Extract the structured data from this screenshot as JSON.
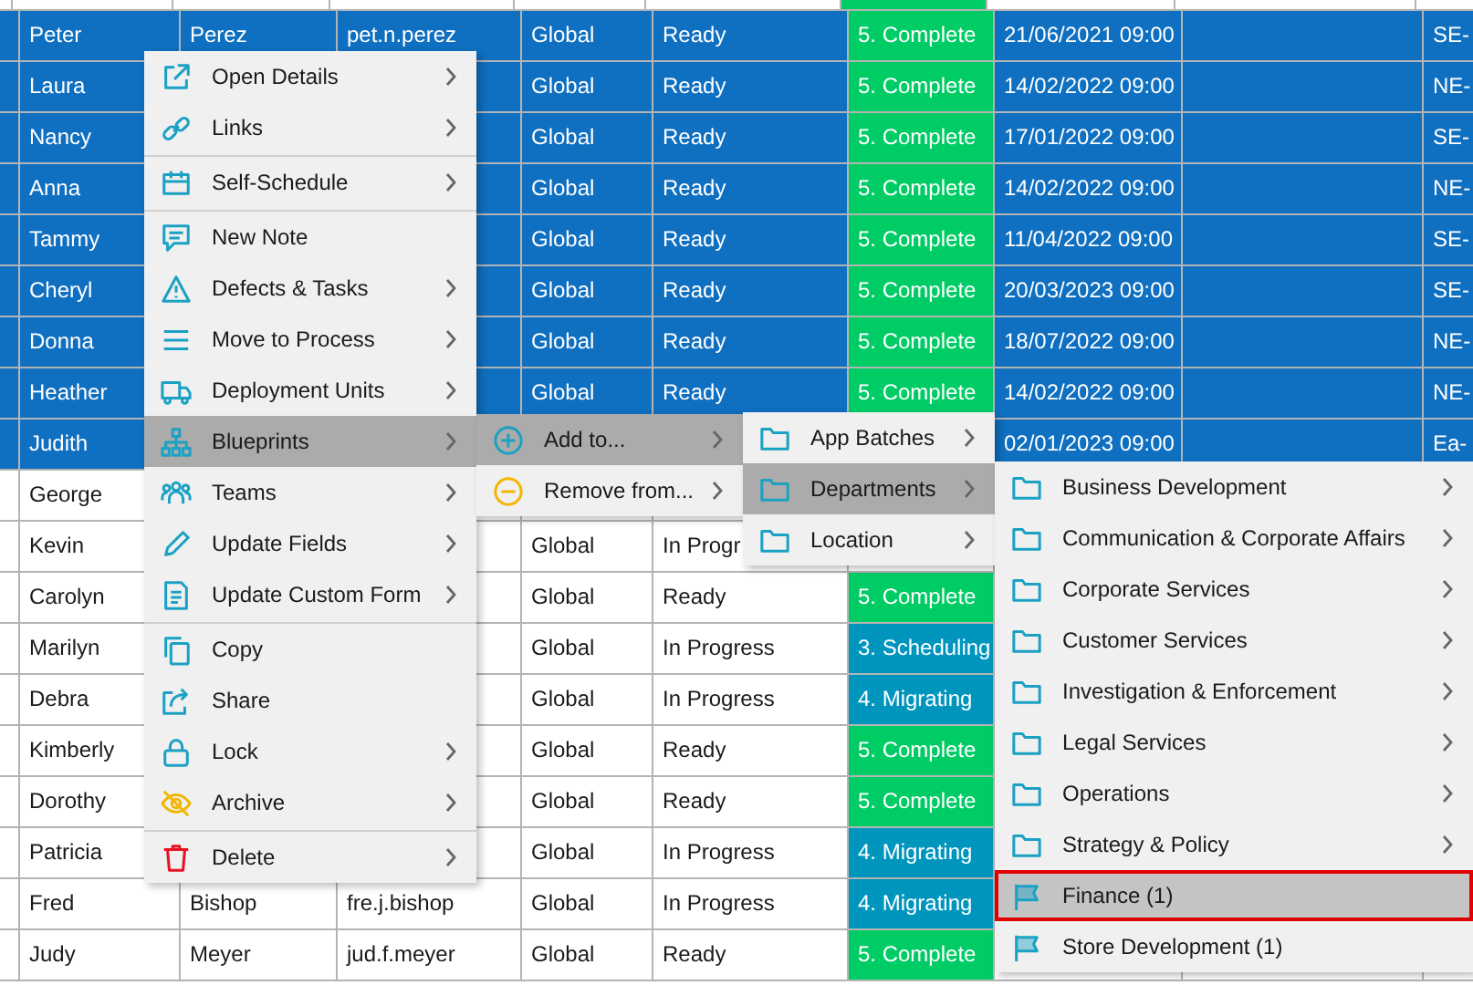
{
  "table": {
    "rows": [
      {
        "selected": true,
        "first_name": "Peter",
        "last_name": "Perez",
        "email": "pet.n.perez",
        "region": "Global",
        "status": "Ready",
        "stage": {
          "label": "5. Complete",
          "color": "#00cc66"
        },
        "date": "21/06/2021 09:00",
        "column_9": "SE-"
      },
      {
        "selected": true,
        "first_name": "Laura",
        "region": "Global",
        "status": "Ready",
        "stage": {
          "label": "5. Complete",
          "color": "#00cc66"
        },
        "date": "14/02/2022 09:00",
        "column_9": "NE-"
      },
      {
        "selected": true,
        "first_name": "Nancy",
        "region": "Global",
        "status": "Ready",
        "stage": {
          "label": "5. Complete",
          "color": "#00cc66"
        },
        "date": "17/01/2022 09:00",
        "column_9": "SE-"
      },
      {
        "selected": true,
        "first_name": "Anna",
        "region": "Global",
        "status": "Ready",
        "stage": {
          "label": "5. Complete",
          "color": "#00cc66"
        },
        "date": "14/02/2022 09:00",
        "column_9": "NE-"
      },
      {
        "selected": true,
        "first_name": "Tammy",
        "region": "Global",
        "status": "Ready",
        "stage": {
          "label": "5. Complete",
          "color": "#00cc66"
        },
        "date": "11/04/2022 09:00",
        "column_9": "SE-"
      },
      {
        "selected": true,
        "first_name": "Cheryl",
        "region": "Global",
        "status": "Ready",
        "stage": {
          "label": "5. Complete",
          "color": "#00cc66"
        },
        "date": "20/03/2023 09:00",
        "column_9": "SE-"
      },
      {
        "selected": true,
        "first_name": "Donna",
        "region": "Global",
        "status": "Ready",
        "stage": {
          "label": "5. Complete",
          "color": "#00cc66"
        },
        "date": "18/07/2022 09:00",
        "column_9": "NE-"
      },
      {
        "selected": true,
        "first_name": "Heather",
        "region": "Global",
        "status": "Ready",
        "stage": {
          "label": "5. Complete",
          "color": "#00cc66"
        },
        "date": "14/02/2022 09:00",
        "column_9": "NE-"
      },
      {
        "selected": true,
        "first_name": "Judith",
        "date": "02/01/2023 09:00",
        "column_9": "Ea-"
      },
      {
        "selected": false,
        "first_name": "George"
      },
      {
        "selected": false,
        "first_name": "Kevin",
        "region": "Global",
        "status": "In Progr"
      },
      {
        "selected": false,
        "first_name": "Carolyn",
        "region": "Global",
        "status": "Ready",
        "stage": {
          "label": "5. Complete",
          "color": "#00cc66"
        }
      },
      {
        "selected": false,
        "first_name": "Marilyn",
        "region": "Global",
        "status": "In Progress",
        "stage": {
          "label": "3. Scheduling",
          "color": "#0095bd"
        }
      },
      {
        "selected": false,
        "first_name": "Debra",
        "region": "Global",
        "status": "In Progress",
        "stage": {
          "label": "4. Migrating",
          "color": "#0095bd"
        }
      },
      {
        "selected": false,
        "first_name": "Kimberly",
        "region": "Global",
        "status": "Ready",
        "stage": {
          "label": "5. Complete",
          "color": "#00cc66"
        }
      },
      {
        "selected": false,
        "first_name": "Dorothy",
        "region": "Global",
        "status": "Ready",
        "stage": {
          "label": "5. Complete",
          "color": "#00cc66"
        }
      },
      {
        "selected": false,
        "first_name": "Patricia",
        "region": "Global",
        "status": "In Progress",
        "stage": {
          "label": "4. Migrating",
          "color": "#0095bd"
        }
      },
      {
        "selected": false,
        "first_name": "Fred",
        "last_name": "Bishop",
        "email": "fre.j.bishop",
        "region": "Global",
        "status": "In Progress",
        "stage": {
          "label": "4. Migrating",
          "color": "#0095bd"
        }
      },
      {
        "selected": false,
        "first_name": "Judy",
        "last_name": "Meyer",
        "email": "jud.f.meyer",
        "region": "Global",
        "status": "Ready",
        "stage": {
          "label": "5. Complete",
          "color": "#00cc66"
        }
      }
    ]
  },
  "context_menu": {
    "groups": [
      [
        {
          "label": "Open Details",
          "arrow": true,
          "selected": false
        },
        {
          "label": "Links",
          "arrow": true,
          "selected": false
        }
      ],
      [
        {
          "label": "Self-Schedule",
          "arrow": true,
          "selected": false
        }
      ],
      [
        {
          "label": "New Note",
          "arrow": false,
          "selected": false
        },
        {
          "label": "Defects & Tasks",
          "arrow": true,
          "selected": false
        },
        {
          "label": "Move to Process",
          "arrow": true,
          "selected": false
        },
        {
          "label": "Deployment Units",
          "arrow": true,
          "selected": false
        },
        {
          "label": "Blueprints",
          "arrow": true,
          "selected": true,
          "submenu": {
            "groups": [
              [
                {
                  "label": "Add to...",
                  "arrow": true,
                  "selected": true,
                  "submenu": {
                    "groups": [
                      [
                        {
                          "label": "App Batches",
                          "arrow": true,
                          "selected": false
                        },
                        {
                          "label": "Departments",
                          "arrow": true,
                          "selected": true,
                          "submenu": {
                            "groups": [
                              [
                                {
                                  "label": "Business Development",
                                  "arrow": true,
                                  "selected": false,
                                  "outlined": false
                                },
                                {
                                  "label": "Communication & Corporate Affairs",
                                  "arrow": true,
                                  "selected": false,
                                  "outlined": false
                                },
                                {
                                  "label": "Corporate Services",
                                  "arrow": true,
                                  "selected": false,
                                  "outlined": false
                                },
                                {
                                  "label": "Customer Services",
                                  "arrow": true,
                                  "selected": false,
                                  "outlined": false
                                },
                                {
                                  "label": "Investigation & Enforcement",
                                  "arrow": true,
                                  "selected": false,
                                  "outlined": false
                                },
                                {
                                  "label": "Legal Services",
                                  "arrow": true,
                                  "selected": false,
                                  "outlined": false
                                },
                                {
                                  "label": "Operations",
                                  "arrow": true,
                                  "selected": false,
                                  "outlined": false
                                },
                                {
                                  "label": "Strategy & Policy",
                                  "arrow": true,
                                  "selected": false,
                                  "outlined": false
                                },
                                {
                                  "label": "Finance (1)",
                                  "arrow": false,
                                  "selected": true,
                                  "outlined": true
                                },
                                {
                                  "label": "Store Development (1)",
                                  "arrow": false,
                                  "selected": false,
                                  "outlined": false
                                }
                              ]
                            ]
                          }
                        },
                        {
                          "label": "Location",
                          "arrow": true,
                          "selected": false
                        }
                      ]
                    ]
                  }
                },
                {
                  "label": "Remove from...",
                  "arrow": true,
                  "selected": false
                }
              ]
            ]
          }
        },
        {
          "label": "Teams",
          "arrow": true,
          "selected": false
        },
        {
          "label": "Update Fields",
          "arrow": true,
          "selected": false
        },
        {
          "label": "Update Custom Form",
          "arrow": true,
          "selected": false
        }
      ],
      [
        {
          "label": "Copy",
          "arrow": false,
          "selected": false
        },
        {
          "label": "Share",
          "arrow": false,
          "selected": false
        },
        {
          "label": "Lock",
          "arrow": true,
          "selected": false
        },
        {
          "label": "Archive",
          "arrow": true,
          "selected": false
        }
      ],
      [
        {
          "label": "Delete",
          "arrow": true,
          "selected": false
        }
      ]
    ]
  }
}
